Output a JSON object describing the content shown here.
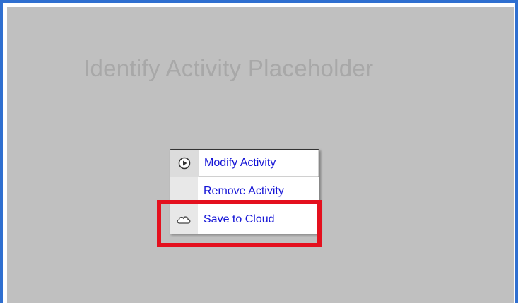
{
  "canvas": {
    "placeholder_title": "Identify Activity Placeholder"
  },
  "context_menu": {
    "items": [
      {
        "label": "Modify Activity",
        "icon": "play-circle-icon"
      },
      {
        "label": "Remove Activity",
        "icon": ""
      },
      {
        "label": "Save to Cloud",
        "icon": "cloud-icon"
      }
    ]
  },
  "colors": {
    "frame_border": "#2f6fd0",
    "canvas_bg": "#c0c0c0",
    "menu_text": "#1515d6",
    "highlight": "#e4101e"
  }
}
